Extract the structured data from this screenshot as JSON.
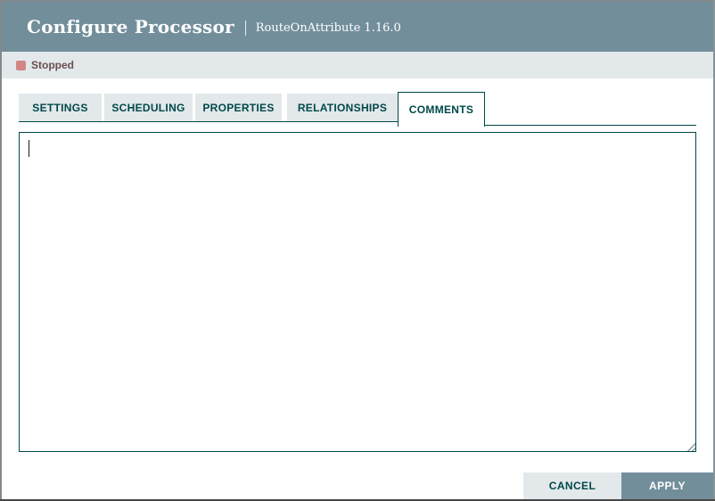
{
  "dialog": {
    "title": "Configure Processor",
    "separator": "|",
    "subtitle": "RouteOnAttribute 1.16.0"
  },
  "status_bar": {
    "label": "Stopped",
    "icon": "stop-square-icon",
    "icon_color": "#d18686",
    "text_color": "#6b4f4f",
    "background": "#e3e8eb"
  },
  "tabs": [
    {
      "label": "SETTINGS",
      "active": false
    },
    {
      "label": "SCHEDULING",
      "active": false
    },
    {
      "label": "PROPERTIES",
      "active": false
    },
    {
      "label": "RELATIONSHIPS",
      "active": false
    },
    {
      "label": "COMMENTS",
      "active": true
    }
  ],
  "comments": {
    "value": "",
    "placeholder": ""
  },
  "footer": {
    "cancel_label": "CANCEL",
    "apply_label": "APPLY"
  },
  "colors": {
    "header_background": "#728e9b",
    "accent_teal": "#004849",
    "tab_inactive_background": "#e3e8eb",
    "apply_button_background": "#728e9b",
    "cancel_button_background": "#e3e8eb",
    "window_edge": "#83898d"
  }
}
